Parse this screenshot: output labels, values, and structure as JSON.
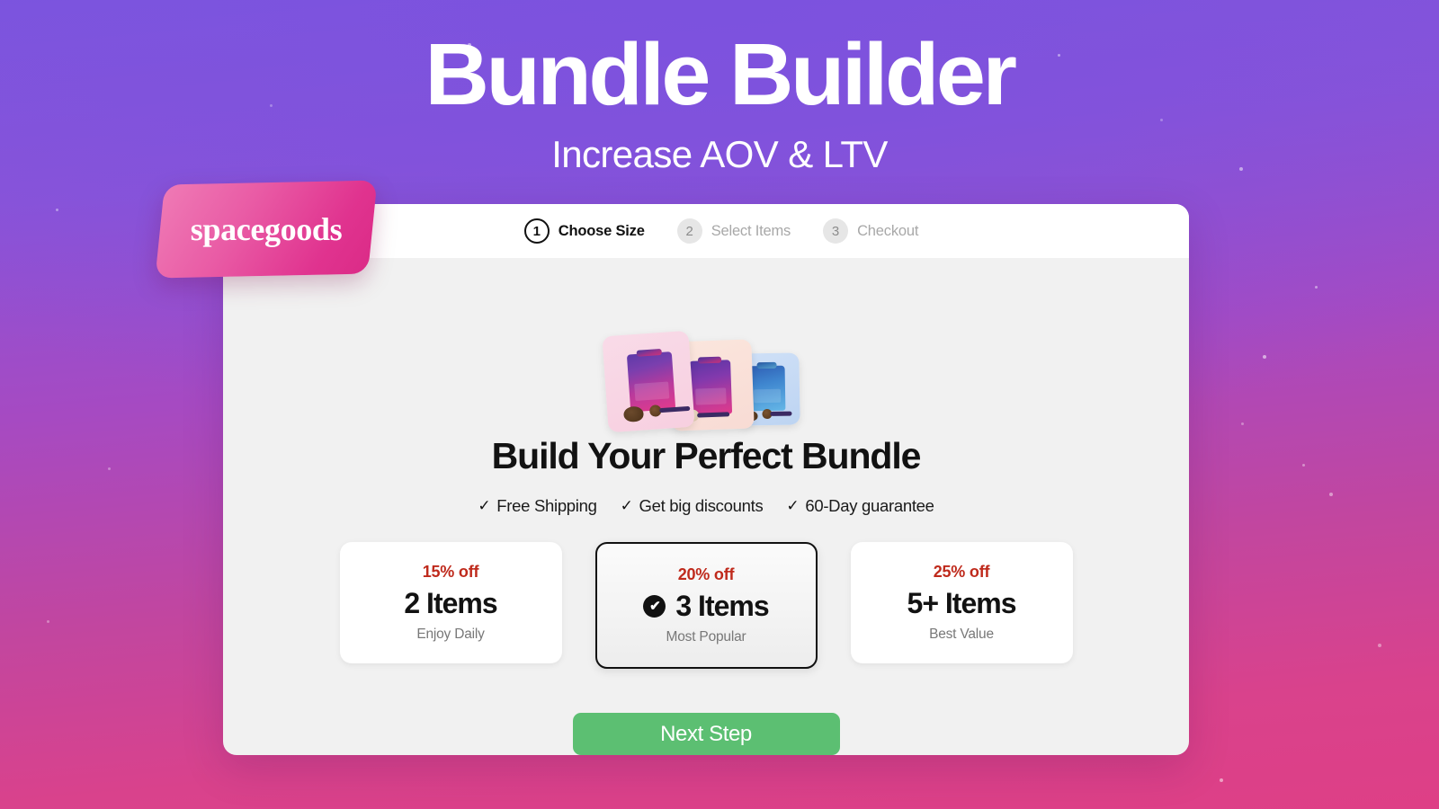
{
  "hero": {
    "title": "Bundle Builder",
    "subtitle": "Increase AOV & LTV"
  },
  "brand": {
    "logo_text": "spacegoods",
    "tag_color": "#e0338f"
  },
  "stepper": {
    "steps": [
      {
        "number": "1",
        "label": "Choose Size",
        "state": "active"
      },
      {
        "number": "2",
        "label": "Select Items",
        "state": "idle"
      },
      {
        "number": "3",
        "label": "Checkout",
        "state": "idle"
      }
    ]
  },
  "main": {
    "heading": "Build Your Perfect Bundle",
    "perks": [
      {
        "check": "✓",
        "label": "Free Shipping"
      },
      {
        "check": "✓",
        "label": "Get big discounts"
      },
      {
        "check": "✓",
        "label": "60-Day guarantee"
      }
    ],
    "options": [
      {
        "discount": "15% off",
        "title": "2 Items",
        "subtitle": "Enjoy Daily",
        "selected": false
      },
      {
        "discount": "20% off",
        "title": "3 Items",
        "subtitle": "Most Popular",
        "selected": true,
        "check": "✔"
      },
      {
        "discount": "25% off",
        "title": "5+ Items",
        "subtitle": "Best Value",
        "selected": false
      }
    ],
    "cta_label": "Next Step",
    "cta_color": "#5cbf72",
    "discount_color": "#bf2a1c"
  }
}
